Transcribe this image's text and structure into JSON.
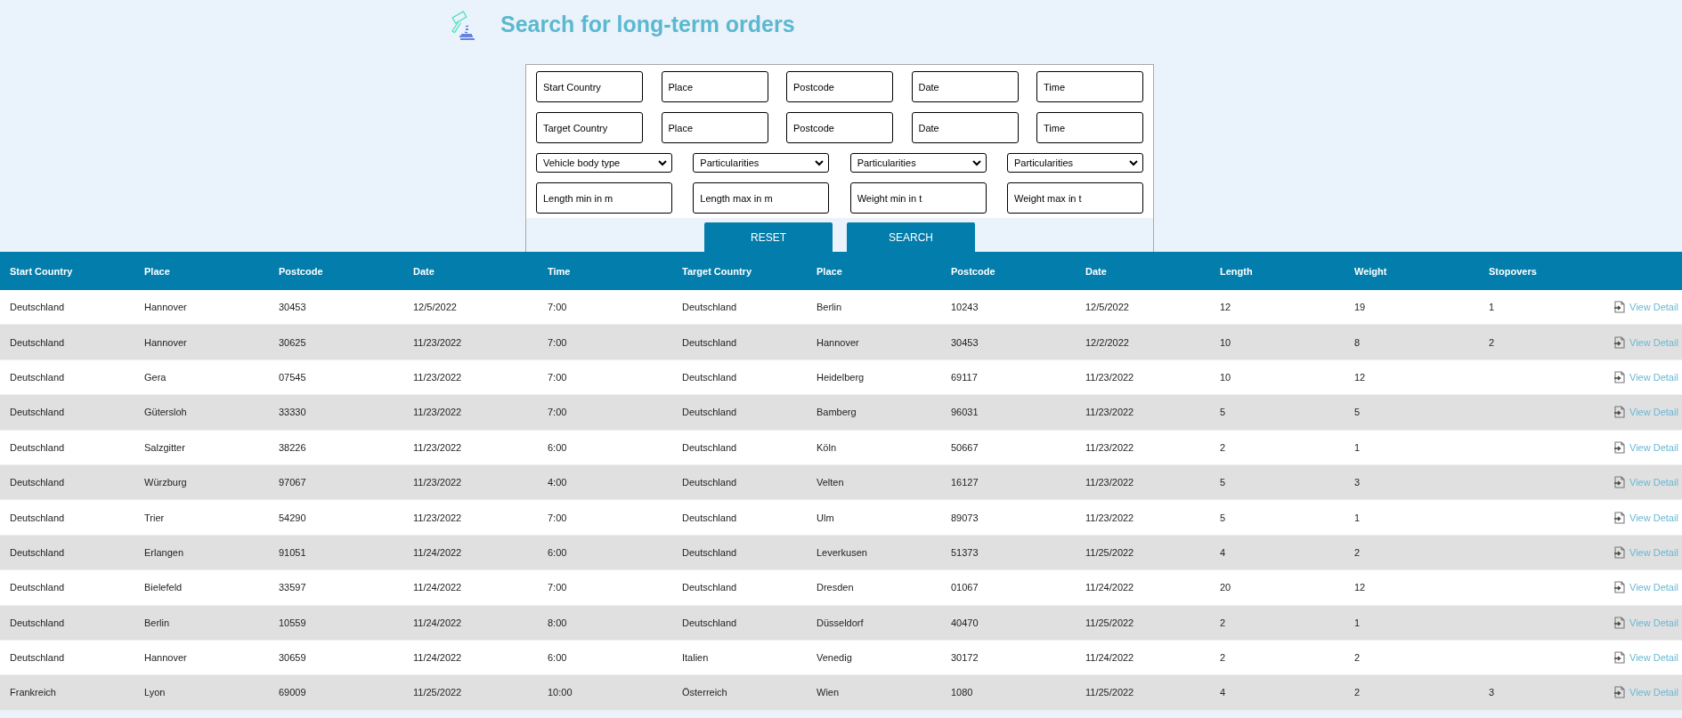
{
  "title": "Search for long-term orders",
  "search": {
    "start_fields": [
      {
        "placeholder": "Start Country"
      },
      {
        "placeholder": "Place"
      },
      {
        "placeholder": "Postcode"
      },
      {
        "placeholder": "Date"
      },
      {
        "placeholder": "Time"
      }
    ],
    "target_fields": [
      {
        "placeholder": "Target Country"
      },
      {
        "placeholder": "Place"
      },
      {
        "placeholder": "Postcode"
      },
      {
        "placeholder": "Date"
      },
      {
        "placeholder": "Time"
      }
    ],
    "dropdowns": [
      {
        "value": "Vehicle body type"
      },
      {
        "value": "Particularities"
      },
      {
        "value": "Particularities"
      },
      {
        "value": "Particularities"
      }
    ],
    "size_fields": [
      {
        "placeholder": "Length min in m"
      },
      {
        "placeholder": "Length max in m"
      },
      {
        "placeholder": "Weight min in t"
      },
      {
        "placeholder": "Weight max in t"
      }
    ],
    "buttons": [
      "RESET",
      "SEARCH"
    ]
  },
  "table": {
    "columns": [
      "Start Country",
      "Place",
      "Postcode",
      "Date",
      "Time",
      "Target Country",
      "Place",
      "Postcode",
      "Date",
      "Length",
      "Weight",
      "Stopovers"
    ],
    "rows": [
      {
        "cells": [
          "Deutschland",
          "Hannover",
          "30453",
          "12/5/2022",
          "7:00",
          "Deutschland",
          "Berlin",
          "10243",
          "12/5/2022",
          "12",
          "19",
          "1"
        ],
        "link": "View Detail"
      },
      {
        "cells": [
          "Deutschland",
          "Hannover",
          "30625",
          "11/23/2022",
          "7:00",
          "Deutschland",
          "Hannover",
          "30453",
          "12/2/2022",
          "10",
          "8",
          "2"
        ],
        "link": "View Detail"
      },
      {
        "cells": [
          "Deutschland",
          "Gera",
          "07545",
          "11/23/2022",
          "7:00",
          "Deutschland",
          "Heidelberg",
          "69117",
          "11/23/2022",
          "10",
          "12"
        ],
        "link": "View Detail"
      },
      {
        "cells": [
          "Deutschland",
          "Gütersloh",
          "33330",
          "11/23/2022",
          "7:00",
          "Deutschland",
          "Bamberg",
          "96031",
          "11/23/2022",
          "5",
          "5"
        ],
        "link": "View Detail"
      },
      {
        "cells": [
          "Deutschland",
          "Salzgitter",
          "38226",
          "11/23/2022",
          "6:00",
          "Deutschland",
          "Köln",
          "50667",
          "11/23/2022",
          "2",
          "1"
        ],
        "link": "View Detail"
      },
      {
        "cells": [
          "Deutschland",
          "Würzburg",
          "97067",
          "11/23/2022",
          "4:00",
          "Deutschland",
          "Velten",
          "16127",
          "11/23/2022",
          "5",
          "3"
        ],
        "link": "View Detail"
      },
      {
        "cells": [
          "Deutschland",
          "Trier",
          "54290",
          "11/23/2022",
          "7:00",
          "Deutschland",
          "Ulm",
          "89073",
          "11/23/2022",
          "5",
          "1"
        ],
        "link": "View Detail"
      },
      {
        "cells": [
          "Deutschland",
          "Erlangen",
          "91051",
          "11/24/2022",
          "6:00",
          "Deutschland",
          "Leverkusen",
          "51373",
          "11/25/2022",
          "4",
          "2"
        ],
        "link": "View Detail"
      },
      {
        "cells": [
          "Deutschland",
          "Bielefeld",
          "33597",
          "11/24/2022",
          "7:00",
          "Deutschland",
          "Dresden",
          "01067",
          "11/24/2022",
          "20",
          "12"
        ],
        "link": "View Detail"
      },
      {
        "cells": [
          "Deutschland",
          "Berlin",
          "10559",
          "11/24/2022",
          "8:00",
          "Deutschland",
          "Düsseldorf",
          "40470",
          "11/25/2022",
          "2",
          "1"
        ],
        "link": "View Detail"
      },
      {
        "cells": [
          "Deutschland",
          "Hannover",
          "30659",
          "11/24/2022",
          "6:00",
          "Italien",
          "Venedig",
          "30172",
          "11/24/2022",
          "2",
          "2"
        ],
        "link": "View Detail"
      },
      {
        "cells": [
          "Frankreich",
          "Lyon",
          "69009",
          "11/25/2022",
          "10:00",
          "Österreich",
          "Wien",
          "1080",
          "11/25/2022",
          "4",
          "2",
          "3"
        ],
        "link": "View Detail"
      }
    ]
  }
}
